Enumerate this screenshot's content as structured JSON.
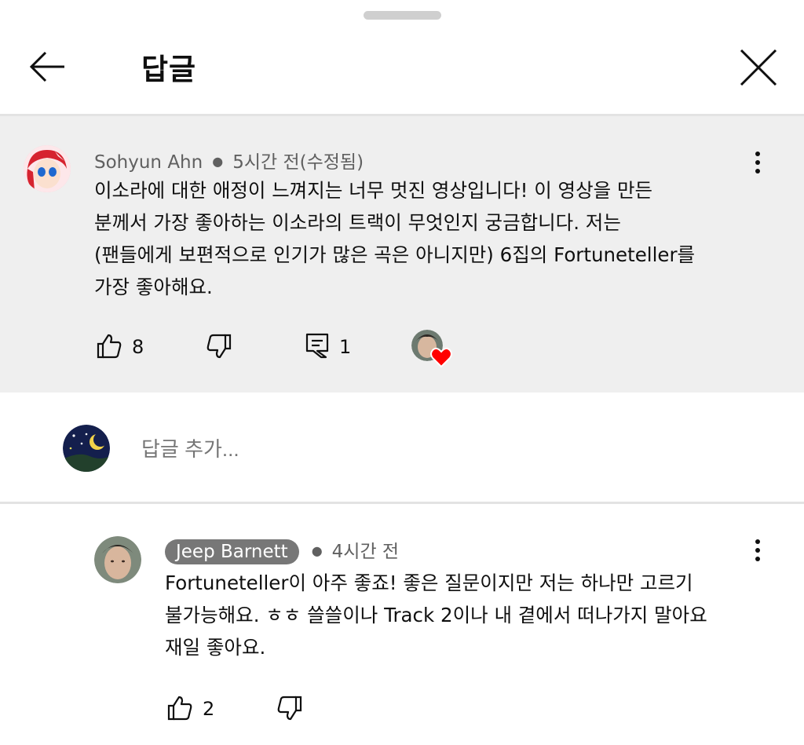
{
  "header": {
    "title": "답글"
  },
  "parent_comment": {
    "author": "Sohyun Ahn",
    "time": "5시간 전(수정됨)",
    "lines": [
      "이소라에 대한 애정이 느껴지는 너무 멋진 영상입니다! 이 영상을 만든",
      "분께서 가장 좋아하는 이소라의 트랙이 무엇인지 궁금합니다. 저는",
      "(팬들에게 보편적으로 인기가 많은 곡은 아니지만) 6집의 Fortuneteller를",
      "가장 좋아해요."
    ],
    "likes": "8",
    "replies": "1"
  },
  "add_reply": {
    "placeholder": "답글 추가..."
  },
  "reply": {
    "author": "Jeep Barnett",
    "time": "4시간 전",
    "lines": [
      "Fortuneteller이 아주 좋죠! 좋은 질문이지만 저는 하나만 고르기",
      "불가능해요. ㅎㅎ 쓸쓸이나 Track 2이나 내 곁에서 떠나가지 말아요",
      "재일 좋아요."
    ],
    "likes": "2"
  },
  "colors": {
    "heart": "#ff0000",
    "badge": "#777777",
    "parent_bg": "#efefef"
  }
}
